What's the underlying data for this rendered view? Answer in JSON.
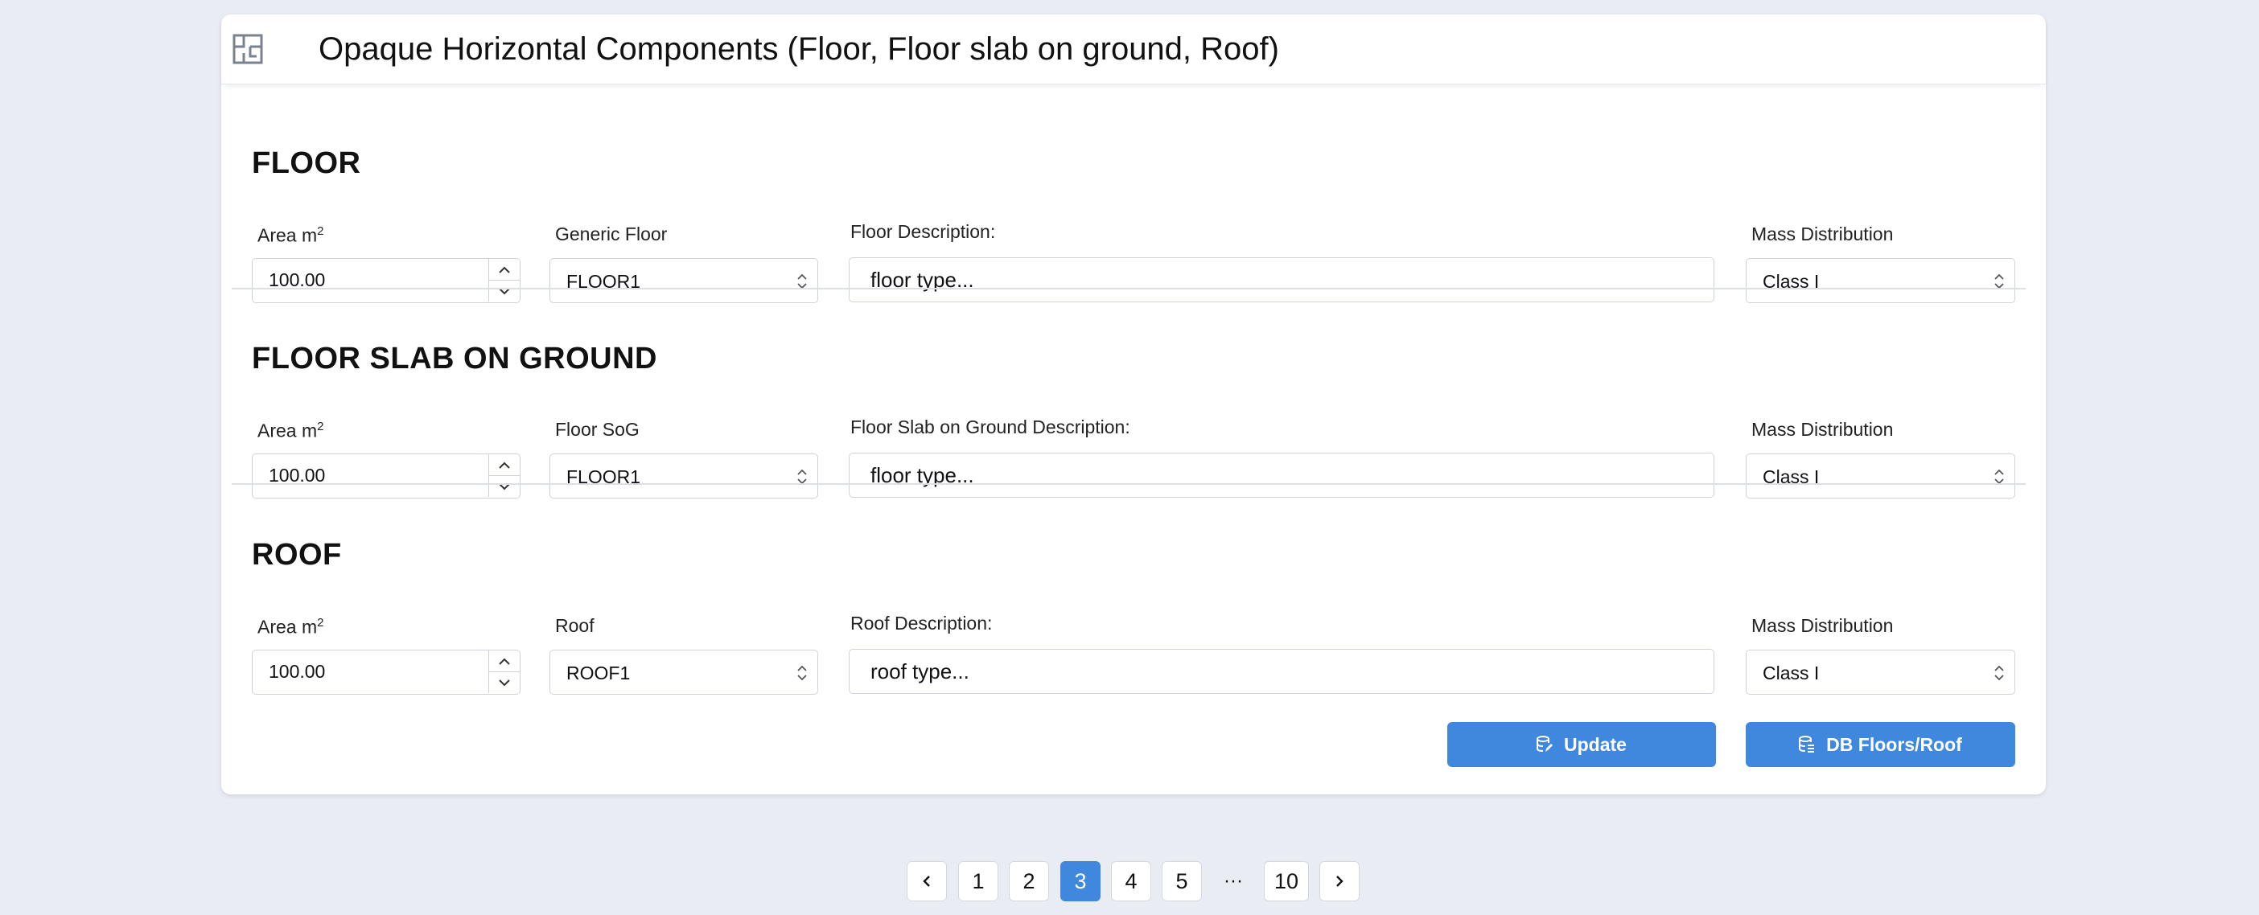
{
  "card": {
    "title": "Opaque Horizontal Components (Floor, Floor slab on ground, Roof)",
    "header_icon": "floor-plan-icon"
  },
  "sections": [
    {
      "title": "FLOOR",
      "area_label": "Area m",
      "area_unit_sup": "2",
      "area_value": "100.00",
      "type_label": "Generic Floor",
      "type_value": "FLOOR1",
      "description_label": "Floor Description:",
      "description_placeholder": "floor type...",
      "mass_label": "Mass Distribution",
      "mass_value": "Class I"
    },
    {
      "title": "FLOOR SLAB ON GROUND",
      "area_label": "Area m",
      "area_unit_sup": "2",
      "area_value": "100.00",
      "type_label": "Floor SoG",
      "type_value": "FLOOR1",
      "description_label": "Floor Slab on Ground Description:",
      "description_placeholder": "floor type...",
      "mass_label": "Mass Distribution",
      "mass_value": "Class I"
    },
    {
      "title": "ROOF",
      "area_label": "Area m",
      "area_unit_sup": "2",
      "area_value": "100.00",
      "type_label": "Roof",
      "type_value": "ROOF1",
      "description_label": "Roof Description:",
      "description_placeholder": "roof type...",
      "mass_label": "Mass Distribution",
      "mass_value": "Class I"
    }
  ],
  "actions": {
    "update_label": "Update",
    "update_icon": "database-edit-icon",
    "db_label": "DB Floors/Roof",
    "db_icon": "database-list-icon"
  },
  "pagination": {
    "prev_icon": "chevron-left-icon",
    "next_icon": "chevron-right-icon",
    "pages": [
      "1",
      "2",
      "3",
      "4",
      "5"
    ],
    "ellipsis": "···",
    "last_page": "10",
    "current": "3"
  },
  "colors": {
    "background": "#e9edf3",
    "accent": "#3f88de",
    "border": "#cfd3d9"
  }
}
